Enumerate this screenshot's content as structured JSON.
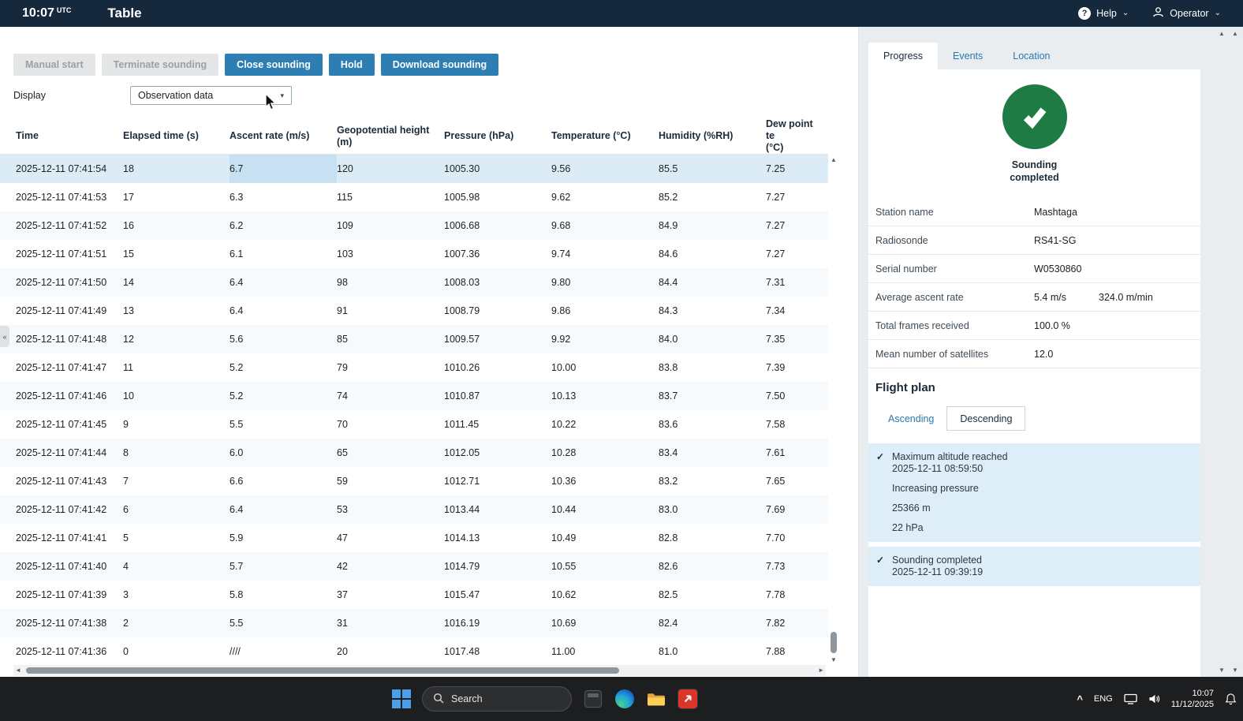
{
  "colors": {
    "accent_blue": "#2d7eb3",
    "topbar_navy": "#16293c",
    "success_green": "#1e7b43",
    "row_highlight": "#dcecf7",
    "cell_highlight": "#c7e1f2",
    "flight_plan_box": "#ddeef9"
  },
  "icons": {
    "question": "?",
    "chevron_down": "⌄",
    "select_chevron": "▾",
    "collapse": "«",
    "check": "✓",
    "scroll_up": "▲",
    "scroll_down": "▼",
    "scroll_left": "◄",
    "scroll_right": "►",
    "caret_up": "^"
  },
  "topbar": {
    "time": "10:07",
    "time_unit": "UTC",
    "title": "Table",
    "help_label": "Help",
    "user_label": "Operator"
  },
  "toolbar": {
    "buttons": [
      {
        "label": "Manual start",
        "enabled": false
      },
      {
        "label": "Terminate sounding",
        "enabled": false
      },
      {
        "label": "Close sounding",
        "enabled": true
      },
      {
        "label": "Hold",
        "enabled": true
      },
      {
        "label": "Download sounding",
        "enabled": true
      }
    ],
    "display_label": "Display",
    "display_value": "Observation data"
  },
  "table": {
    "columns": [
      "Time",
      "Elapsed time (s)",
      "Ascent rate (m/s)",
      "Geopotential height\n(m)",
      "Pressure (hPa)",
      "Temperature (°C)",
      "Humidity (%RH)",
      "Dew point te\n(°C)"
    ],
    "rows": [
      [
        "2025-12-11 07:41:54",
        "18",
        "6.7",
        "120",
        "1005.30",
        "9.56",
        "85.5",
        "7.25"
      ],
      [
        "2025-12-11 07:41:53",
        "17",
        "6.3",
        "115",
        "1005.98",
        "9.62",
        "85.2",
        "7.27"
      ],
      [
        "2025-12-11 07:41:52",
        "16",
        "6.2",
        "109",
        "1006.68",
        "9.68",
        "84.9",
        "7.27"
      ],
      [
        "2025-12-11 07:41:51",
        "15",
        "6.1",
        "103",
        "1007.36",
        "9.74",
        "84.6",
        "7.27"
      ],
      [
        "2025-12-11 07:41:50",
        "14",
        "6.4",
        "98",
        "1008.03",
        "9.80",
        "84.4",
        "7.31"
      ],
      [
        "2025-12-11 07:41:49",
        "13",
        "6.4",
        "91",
        "1008.79",
        "9.86",
        "84.3",
        "7.34"
      ],
      [
        "2025-12-11 07:41:48",
        "12",
        "5.6",
        "85",
        "1009.57",
        "9.92",
        "84.0",
        "7.35"
      ],
      [
        "2025-12-11 07:41:47",
        "11",
        "5.2",
        "79",
        "1010.26",
        "10.00",
        "83.8",
        "7.39"
      ],
      [
        "2025-12-11 07:41:46",
        "10",
        "5.2",
        "74",
        "1010.87",
        "10.13",
        "83.7",
        "7.50"
      ],
      [
        "2025-12-11 07:41:45",
        "9",
        "5.5",
        "70",
        "1011.45",
        "10.22",
        "83.6",
        "7.58"
      ],
      [
        "2025-12-11 07:41:44",
        "8",
        "6.0",
        "65",
        "1012.05",
        "10.28",
        "83.4",
        "7.61"
      ],
      [
        "2025-12-11 07:41:43",
        "7",
        "6.6",
        "59",
        "1012.71",
        "10.36",
        "83.2",
        "7.65"
      ],
      [
        "2025-12-11 07:41:42",
        "6",
        "6.4",
        "53",
        "1013.44",
        "10.44",
        "83.0",
        "7.69"
      ],
      [
        "2025-12-11 07:41:41",
        "5",
        "5.9",
        "47",
        "1014.13",
        "10.49",
        "82.8",
        "7.70"
      ],
      [
        "2025-12-11 07:41:40",
        "4",
        "5.7",
        "42",
        "1014.79",
        "10.55",
        "82.6",
        "7.73"
      ],
      [
        "2025-12-11 07:41:39",
        "3",
        "5.8",
        "37",
        "1015.47",
        "10.62",
        "82.5",
        "7.78"
      ],
      [
        "2025-12-11 07:41:38",
        "2",
        "5.5",
        "31",
        "1016.19",
        "10.69",
        "82.4",
        "7.82"
      ],
      [
        "2025-12-11 07:41:36",
        "0",
        "////",
        "20",
        "1017.48",
        "11.00",
        "81.0",
        "7.88"
      ]
    ]
  },
  "panel": {
    "tabs": [
      "Progress",
      "Events",
      "Location"
    ],
    "active_tab": "Progress",
    "status": [
      "Sounding",
      "completed"
    ],
    "details": [
      {
        "label": "Station name",
        "value": "Mashtaga",
        "value2": ""
      },
      {
        "label": "Radiosonde",
        "value": "RS41-SG",
        "value2": ""
      },
      {
        "label": "Serial number",
        "value": "W0530860",
        "value2": ""
      },
      {
        "label": "Average ascent rate",
        "value": "5.4 m/s",
        "value2": "324.0 m/min"
      },
      {
        "label": "Total frames received",
        "value": "100.0 %",
        "value2": ""
      },
      {
        "label": "Mean number of satellites",
        "value": "12.0",
        "value2": ""
      }
    ],
    "flight_plan": {
      "title": "Flight plan",
      "tabs": [
        "Ascending",
        "Descending"
      ],
      "active_tab": "Descending",
      "groups": [
        {
          "items": [
            {
              "checked": true,
              "lines": [
                "Maximum altitude reached",
                "2025-12-11 08:59:50"
              ]
            },
            {
              "checked": false,
              "lines": [
                "Increasing pressure"
              ]
            },
            {
              "checked": false,
              "lines": [
                "25366 m"
              ]
            },
            {
              "checked": false,
              "lines": [
                "22 hPa"
              ]
            }
          ]
        },
        {
          "items": [
            {
              "checked": true,
              "lines": [
                "Sounding completed",
                "2025-12-11 09:39:19"
              ]
            }
          ]
        }
      ]
    }
  },
  "taskbar": {
    "search_label": "Search",
    "language": "ENG",
    "time": "10:07",
    "date": "11/12/2025"
  }
}
